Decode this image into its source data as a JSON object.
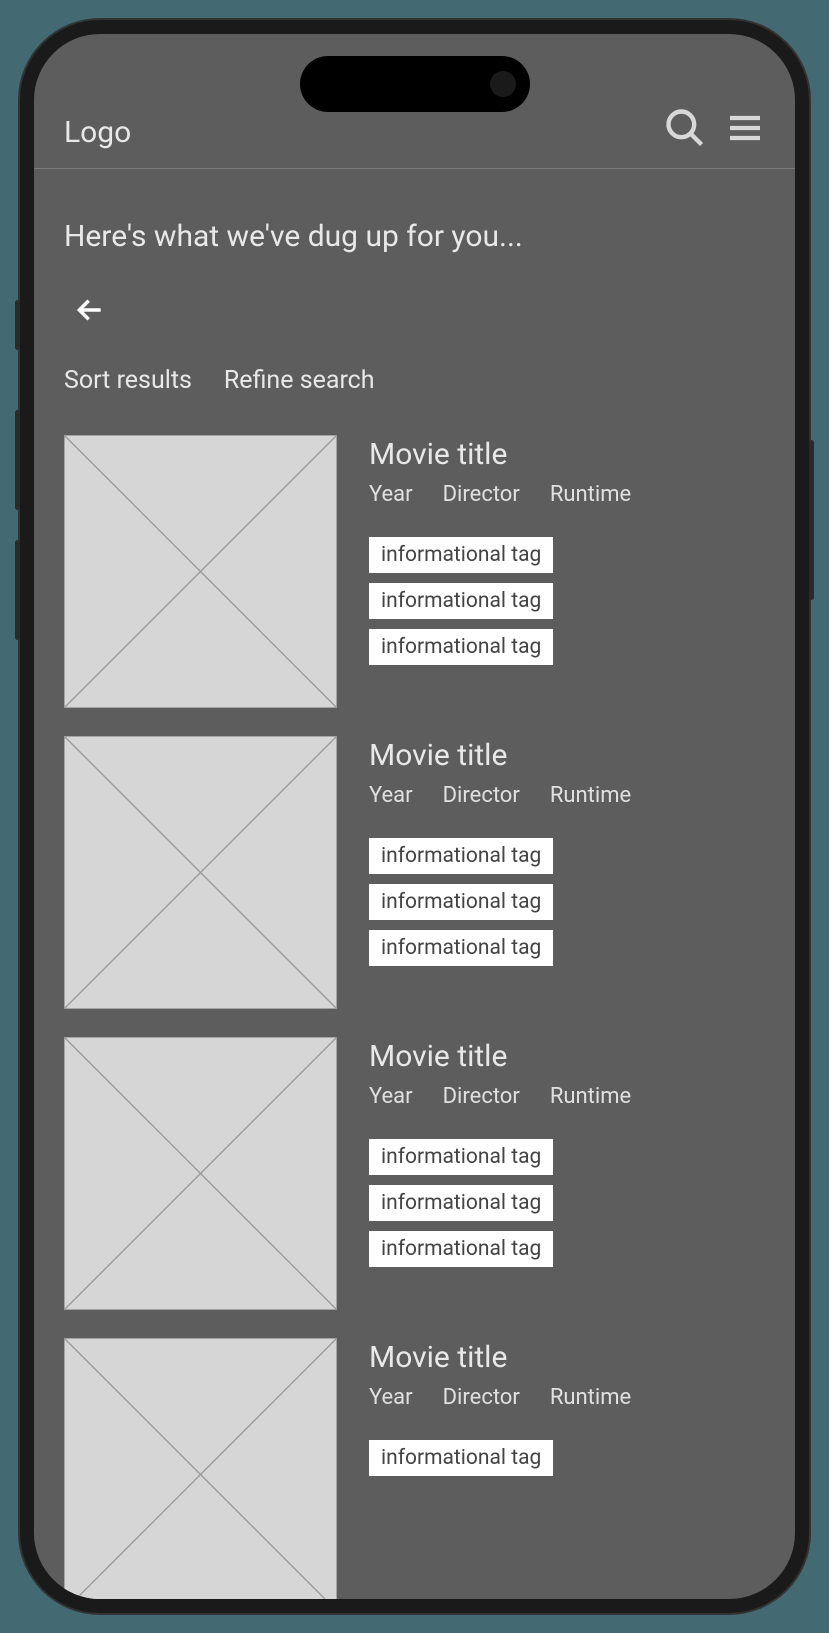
{
  "header": {
    "logo": "Logo"
  },
  "page": {
    "heading": "Here's what we've dug up for you...",
    "sort_label": "Sort results",
    "refine_label": "Refine search"
  },
  "results": [
    {
      "title": "Movie title",
      "year": "Year",
      "director": "Director",
      "runtime": "Runtime",
      "tags": [
        "informational tag",
        "informational tag",
        "informational tag"
      ]
    },
    {
      "title": "Movie title",
      "year": "Year",
      "director": "Director",
      "runtime": "Runtime",
      "tags": [
        "informational tag",
        "informational tag",
        "informational tag"
      ]
    },
    {
      "title": "Movie title",
      "year": "Year",
      "director": "Director",
      "runtime": "Runtime",
      "tags": [
        "informational tag",
        "informational tag",
        "informational tag"
      ]
    },
    {
      "title": "Movie title",
      "year": "Year",
      "director": "Director",
      "runtime": "Runtime",
      "tags": [
        "informational tag"
      ]
    }
  ]
}
